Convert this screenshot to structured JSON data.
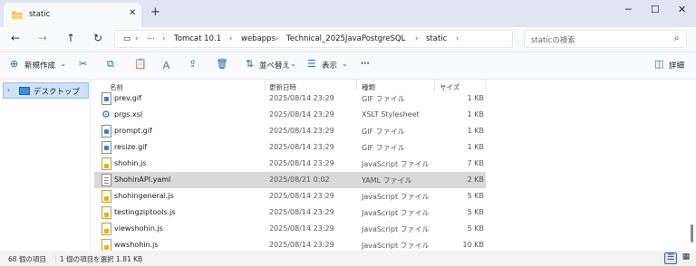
{
  "window": {
    "tab_title": "static",
    "close_tab_glyph": "✕",
    "new_tab_glyph": "+",
    "minimize_glyph": "─",
    "maximize_glyph": "☐",
    "close_glyph": "✕"
  },
  "address": {
    "back_glyph": "←",
    "forward_glyph": "→",
    "up_glyph": "↑",
    "refresh_glyph": "↻",
    "pc_glyph": "▭",
    "more_glyph": "⋯",
    "separator": "›",
    "breadcrumbs": [
      "Tomcat 10.1",
      "webapps",
      "Technical_2025JavaPostgreSQL",
      "static"
    ],
    "search_placeholder": "staticの検索",
    "search_glyph": "⌕"
  },
  "toolbar": {
    "new_label": "新規作成",
    "sort_label": "並べ替え",
    "view_label": "表示",
    "more_glyph": "···",
    "details_label": "詳細",
    "icons": {
      "new": "⊕",
      "cut": "✂",
      "copy": "⧉",
      "paste": "📋",
      "rename": "Ａ",
      "share": "⇪",
      "delete": "🗑",
      "sort": "⇅",
      "view": "☰",
      "details": "◫"
    }
  },
  "nav_pane": {
    "chevron": "›",
    "item_label": "デスクトップ"
  },
  "columns": {
    "name": "名前",
    "date": "更新日時",
    "type": "種類",
    "size": "サイズ"
  },
  "files": [
    {
      "name": "prev.gif",
      "date": "2025/08/14 23:29",
      "type": "GIF ファイル",
      "size": "1 KB",
      "icon": "gif"
    },
    {
      "name": "prgs.xsl",
      "date": "2025/08/14 23:29",
      "type": "XSLT Stylesheet",
      "size": "1 KB",
      "icon": "xsl"
    },
    {
      "name": "prompt.gif",
      "date": "2025/08/14 23:29",
      "type": "GIF ファイル",
      "size": "1 KB",
      "icon": "gif"
    },
    {
      "name": "resize.gif",
      "date": "2025/08/14 23:29",
      "type": "GIF ファイル",
      "size": "1 KB",
      "icon": "gif"
    },
    {
      "name": "shohin.js",
      "date": "2025/08/14 23:29",
      "type": "JavaScript ファイル",
      "size": "7 KB",
      "icon": "js"
    },
    {
      "name": "ShohinAPI.yaml",
      "date": "2025/08/21 0:02",
      "type": "YAML ファイル",
      "size": "2 KB",
      "icon": "yaml",
      "selected": true
    },
    {
      "name": "shohingeneral.js",
      "date": "2025/08/14 23:29",
      "type": "JavaScript ファイル",
      "size": "5 KB",
      "icon": "js"
    },
    {
      "name": "testingziptools.js",
      "date": "2025/08/14 23:29",
      "type": "JavaScript ファイル",
      "size": "5 KB",
      "icon": "js"
    },
    {
      "name": "viewshohin.js",
      "date": "2025/08/14 23:29",
      "type": "JavaScript ファイル",
      "size": "5 KB",
      "icon": "js"
    },
    {
      "name": "wwshohin.js",
      "date": "2025/08/14 23:29",
      "type": "JavaScript ファイル",
      "size": "10 KB",
      "icon": "js"
    }
  ],
  "status": {
    "item_count": "68 個の項目",
    "selection": "1 個の項目を選択  1.81 KB",
    "details_view_glyph": "☰",
    "tiles_view_glyph": "▦"
  },
  "colors": {
    "accent": "#2b63b9",
    "selected_row": "#d9d9d9",
    "nav_selected": "#cfe3f7"
  }
}
